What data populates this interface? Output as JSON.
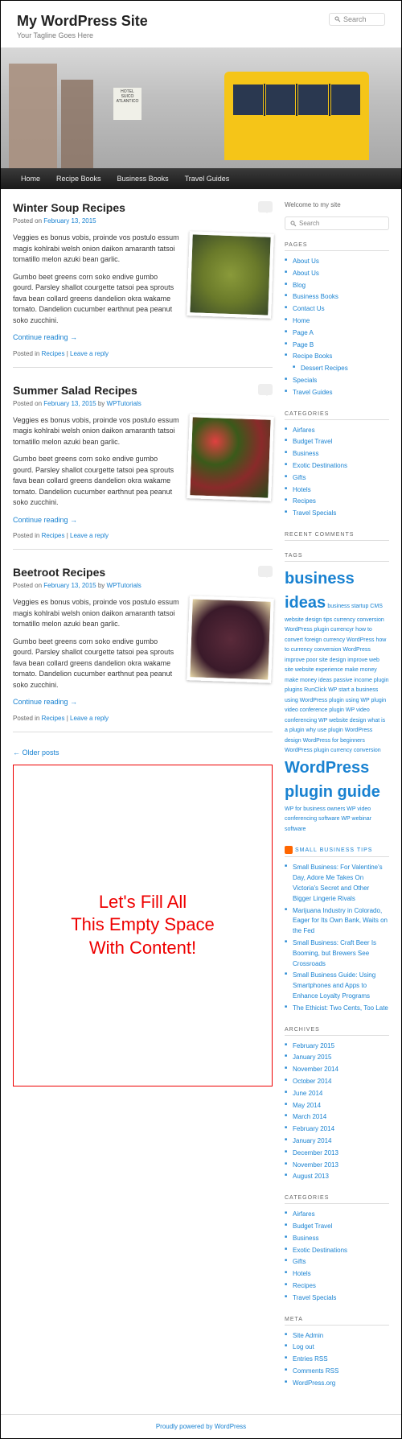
{
  "header": {
    "site_title": "My WordPress Site",
    "tagline": "Your Tagline Goes Here",
    "search_placeholder": "Search",
    "hero_sign": "HOTEL SUICO ATLANTICO"
  },
  "nav": [
    "Home",
    "Recipe Books",
    "Business Books",
    "Travel Guides"
  ],
  "posts": [
    {
      "title": "Winter Soup Recipes",
      "posted_on": "Posted on ",
      "date": "February 13, 2015",
      "para1": "Veggies es bonus vobis, proinde vos postulo essum magis kohlrabi welsh onion daikon amaranth tatsoi tomatillo melon azuki bean garlic.",
      "para2": "Gumbo beet greens corn soko endive gumbo gourd. Parsley shallot courgette tatsoi pea sprouts fava bean collard greens dandelion okra wakame tomato. Dandelion cucumber earthnut pea peanut soko zucchini.",
      "continue": "Continue reading →",
      "posted_in": "Posted in ",
      "category": "Recipes",
      "leave_reply": "Leave a reply",
      "img": "img-soup"
    },
    {
      "title": "Summer Salad Recipes",
      "posted_on": "Posted on ",
      "date": "February 13, 2015",
      "by": " by ",
      "author": "WPTutorials",
      "para1": "Veggies es bonus vobis, proinde vos postulo essum magis kohlrabi welsh onion daikon amaranth tatsoi tomatillo melon azuki bean garlic.",
      "para2": "Gumbo beet greens corn soko endive gumbo gourd. Parsley shallot courgette tatsoi pea sprouts fava bean collard greens dandelion okra wakame tomato. Dandelion cucumber earthnut pea peanut soko zucchini.",
      "continue": "Continue reading →",
      "posted_in": "Posted in ",
      "category": "Recipes",
      "leave_reply": "Leave a reply",
      "img": "img-salad"
    },
    {
      "title": "Beetroot Recipes",
      "posted_on": "Posted on ",
      "date": "February 13, 2015",
      "by": " by ",
      "author": "WPTutorials",
      "para1": "Veggies es bonus vobis, proinde vos postulo essum magis kohlrabi welsh onion daikon amaranth tatsoi tomatillo melon azuki bean garlic.",
      "para2": "Gumbo beet greens corn soko endive gumbo gourd. Parsley shallot courgette tatsoi pea sprouts fava bean collard greens dandelion okra wakame tomato. Dandelion cucumber earthnut pea peanut soko zucchini.",
      "continue": "Continue reading →",
      "posted_in": "Posted in ",
      "category": "Recipes",
      "leave_reply": "Leave a reply",
      "img": "img-beet"
    }
  ],
  "older_posts": "← Older posts",
  "empty_box": "Let's Fill All\nThis Empty Space\nWith Content!",
  "sidebar": {
    "welcome": "Welcome to my site",
    "search_placeholder": "Search",
    "pages_title": "PAGES",
    "pages": [
      "About Us",
      "About Us",
      "Blog",
      "Business Books",
      "Contact Us",
      "Home",
      "Page A",
      "Page B",
      "Recipe Books"
    ],
    "pages_nested": "Dessert Recipes",
    "pages2": [
      "Specials",
      "Travel Guides"
    ],
    "categories_title": "CATEGORIES",
    "categories": [
      "Airfares",
      "Budget Travel",
      "Business",
      "Exotic Destinations",
      "Gifts",
      "Hotels",
      "Recipes",
      "Travel Specials"
    ],
    "recent_comments_title": "RECENT COMMENTS",
    "tags_title": "TAGS",
    "tag_big1": "business ideas",
    "tag_items": "business startup CMS website design tips currency conversion WordPress plugin currencyr how to convert foreign currency WordPress how to currency conversion WordPress improve poor site design improve web site website experience make money make money ideas passive income plugin plugins RunClick WP start a business using WordPress plugin using WP plugin video conference plugin WP video conferencing WP website design what is a plugin why use plugin WordPress design WordPress for beginners WordPress plugin currency conversion",
    "tag_big2": "WordPress plugin guide",
    "tag_items2": "WP for business owners WP video conferencing software WP webinar software",
    "rss_title": "SMALL BUSINESS TIPS",
    "rss_items": [
      "Small Business: For Valentine's Day, Adore Me Takes On Victoria's Secret and Other Bigger Lingerie Rivals",
      "Marijuana Industry in Colorado, Eager for Its Own Bank, Waits on the Fed",
      "Small Business: Craft Beer Is Booming, but Brewers See Crossroads",
      "Small Business Guide: Using Smartphones and Apps to Enhance Loyalty Programs",
      "The Ethicist: Two Cents, Too Late"
    ],
    "archives_title": "ARCHIVES",
    "archives": [
      "February 2015",
      "January 2015",
      "November 2014",
      "October 2014",
      "June 2014",
      "May 2014",
      "March 2014",
      "February 2014",
      "January 2014",
      "December 2013",
      "November 2013",
      "August 2013"
    ],
    "categories2_title": "CATEGORIES",
    "meta_title": "META",
    "meta": [
      "Site Admin",
      "Log out",
      "Entries RSS",
      "Comments RSS",
      "WordPress.org"
    ]
  },
  "footer": "Proudly powered by WordPress"
}
